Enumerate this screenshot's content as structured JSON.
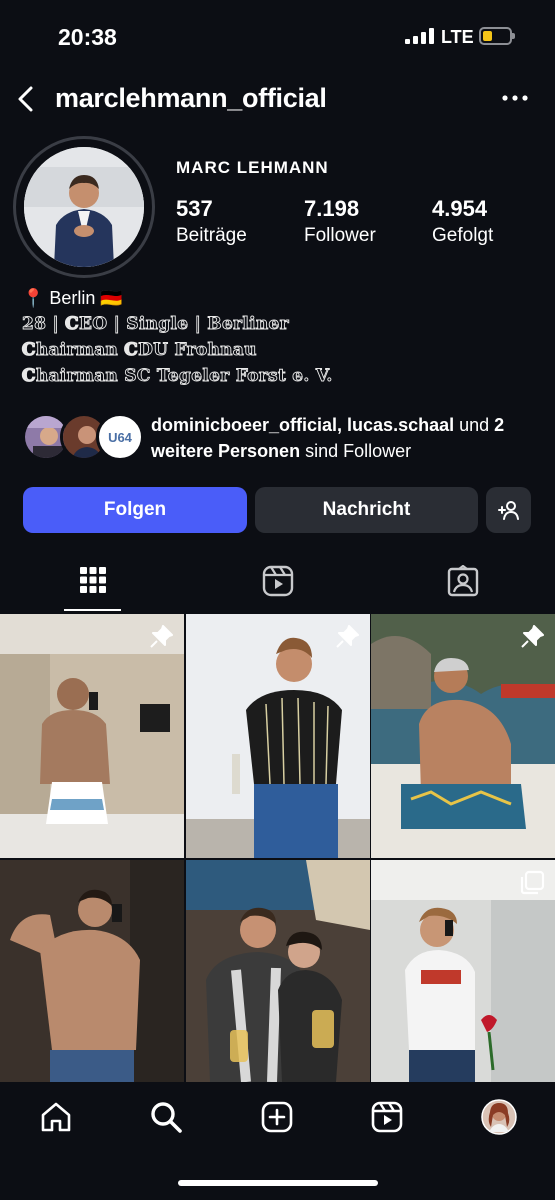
{
  "status_bar": {
    "time": "20:38",
    "network": "LTE"
  },
  "header": {
    "username": "marclehmann_official"
  },
  "profile": {
    "display_name": "MARC LEHMANN",
    "stats": [
      {
        "value": "537",
        "label": "Beiträge"
      },
      {
        "value": "7.198",
        "label": "Follower"
      },
      {
        "value": "4.954",
        "label": "Gefolgt"
      }
    ],
    "bio": {
      "location": "📍 Berlin 🇩🇪",
      "line1": "28 | ℂEO | Single | Berliner",
      "line2": "ℂhairman ℂDU Frohnau",
      "line3": "ℂhairman SC Tegeler Forst e. V."
    }
  },
  "mutual_followers": {
    "names": "dominicboeer_official, lucas.schaal",
    "connector": " und ",
    "others": "2 weitere Personen",
    "suffix": " sind Follower",
    "third_avatar_text": "U64"
  },
  "actions": {
    "follow": "Folgen",
    "message": "Nachricht"
  },
  "tabs": [
    "grid",
    "reels",
    "tagged"
  ],
  "posts": [
    {
      "pinned": true
    },
    {
      "pinned": true
    },
    {
      "pinned": true
    },
    {
      "pinned": false
    },
    {
      "pinned": false
    },
    {
      "pinned": false,
      "multiple": true
    }
  ],
  "bottom_nav": [
    "home",
    "search",
    "create",
    "reels",
    "profile"
  ],
  "colors": {
    "accent": "#4a5df9",
    "background": "#0c0e14",
    "button": "#2a2d34"
  }
}
